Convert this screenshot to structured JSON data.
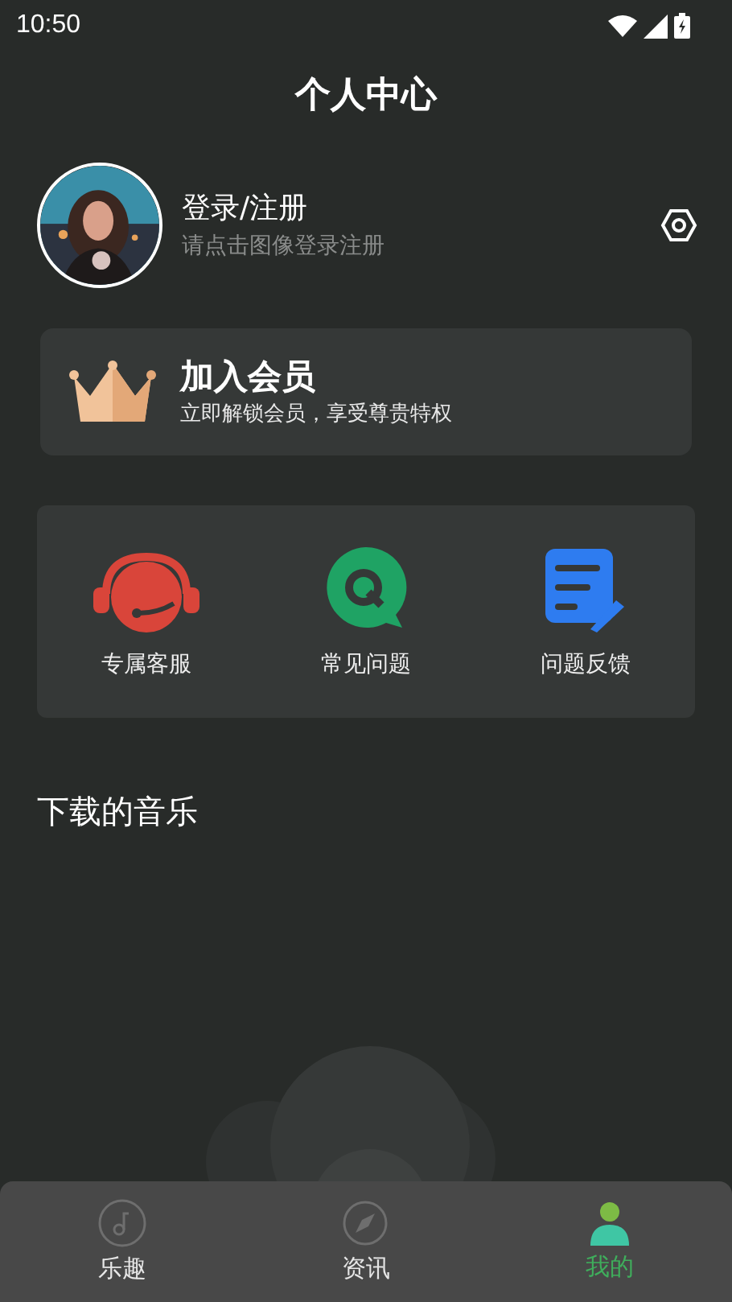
{
  "status_bar": {
    "time": "10:50"
  },
  "header": {
    "title": "个人中心"
  },
  "profile": {
    "name": "登录/注册",
    "hint": "请点击图像登录注册"
  },
  "vip_banner": {
    "title": "加入会员",
    "subtitle": "立即解锁会员，享受尊贵特权"
  },
  "services": [
    {
      "kind": "headset",
      "label": "专属客服"
    },
    {
      "kind": "faq",
      "label": "常见问题"
    },
    {
      "kind": "feedback",
      "label": "问题反馈"
    }
  ],
  "downloads": {
    "title": "下载的音乐"
  },
  "tabs": [
    {
      "kind": "music",
      "label": "乐趣",
      "selected": false
    },
    {
      "kind": "compass",
      "label": "资讯",
      "selected": false
    },
    {
      "kind": "person",
      "label": "我的",
      "selected": true
    }
  ]
}
